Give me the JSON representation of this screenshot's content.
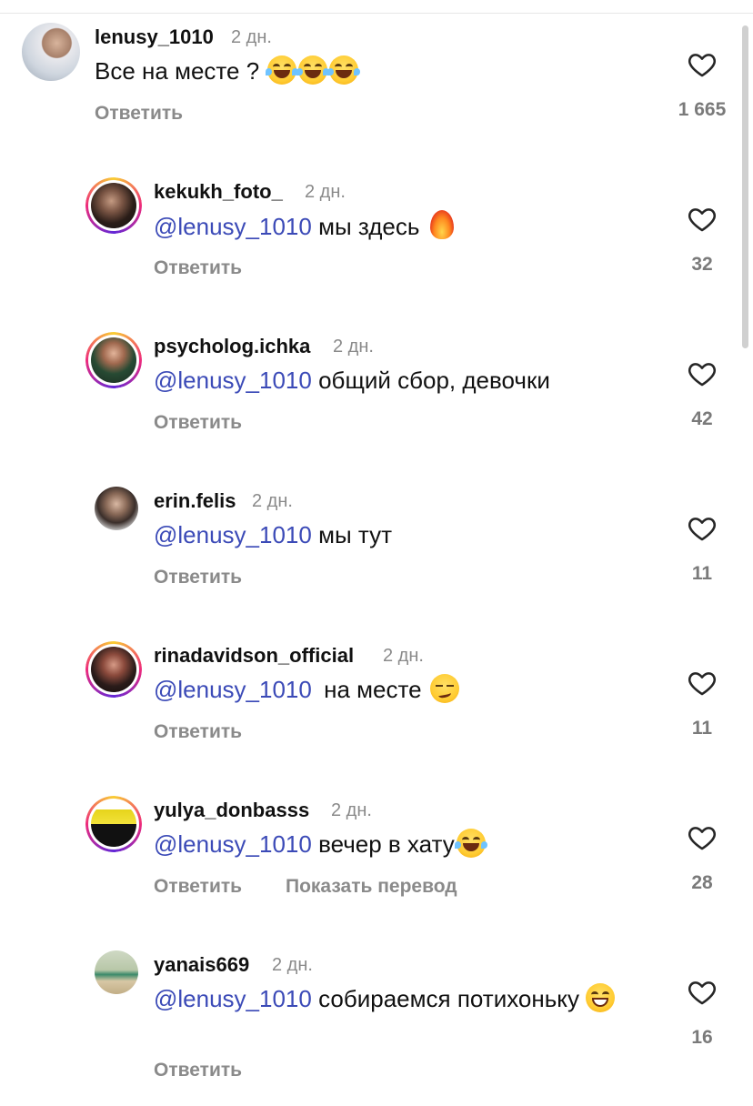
{
  "comments": [
    {
      "username": "lenusy_1010",
      "time": "2 дн.",
      "mention": "",
      "text": "Все на месте ?",
      "emoji": [
        "face-with-tears-of-joy",
        "face-with-tears-of-joy",
        "face-with-tears-of-joy"
      ],
      "reply_label": "Ответить",
      "likes": "1 665"
    },
    {
      "username": "kekukh_foto_",
      "time": "2 дн.",
      "mention": "@lenusy_1010",
      "text": "мы здесь",
      "emoji": [
        "fire"
      ],
      "reply_label": "Ответить",
      "likes": "32"
    },
    {
      "username": "psycholog.ichka",
      "time": "2 дн.",
      "mention": "@lenusy_1010",
      "text": "общий сбор, девочки",
      "emoji": [],
      "reply_label": "Ответить",
      "likes": "42"
    },
    {
      "username": "erin.felis",
      "time": "2 дн.",
      "mention": "@lenusy_1010",
      "text": "мы тут",
      "emoji": [],
      "reply_label": "Ответить",
      "likes": "11"
    },
    {
      "username": "rinadavidson_official",
      "time": "2 дн.",
      "mention": "@lenusy_1010",
      "text": "на месте",
      "emoji": [
        "smirking-face"
      ],
      "reply_label": "Ответить",
      "likes": "11"
    },
    {
      "username": "yulya_donbasss",
      "time": "2 дн.",
      "mention": "@lenusy_1010",
      "text": "вечер в хату",
      "emoji": [
        "face-with-tears-of-joy"
      ],
      "reply_label": "Ответить",
      "translate_label": "Показать перевод",
      "likes": "28"
    },
    {
      "username": "yanais669",
      "time": "2 дн.",
      "mention": "@lenusy_1010",
      "text": "собираемся потихоньку",
      "emoji": [
        "grinning-face-with-smiling-eyes"
      ],
      "reply_label": "Ответить",
      "likes": "16"
    }
  ],
  "colors": {
    "mention": "#3b4ab7",
    "secondary_text": "#8a8a8a",
    "story_ring": [
      "#f9ce34",
      "#ee2a7b",
      "#6228d7"
    ]
  },
  "icons": {
    "like": "heart-outline-icon"
  }
}
